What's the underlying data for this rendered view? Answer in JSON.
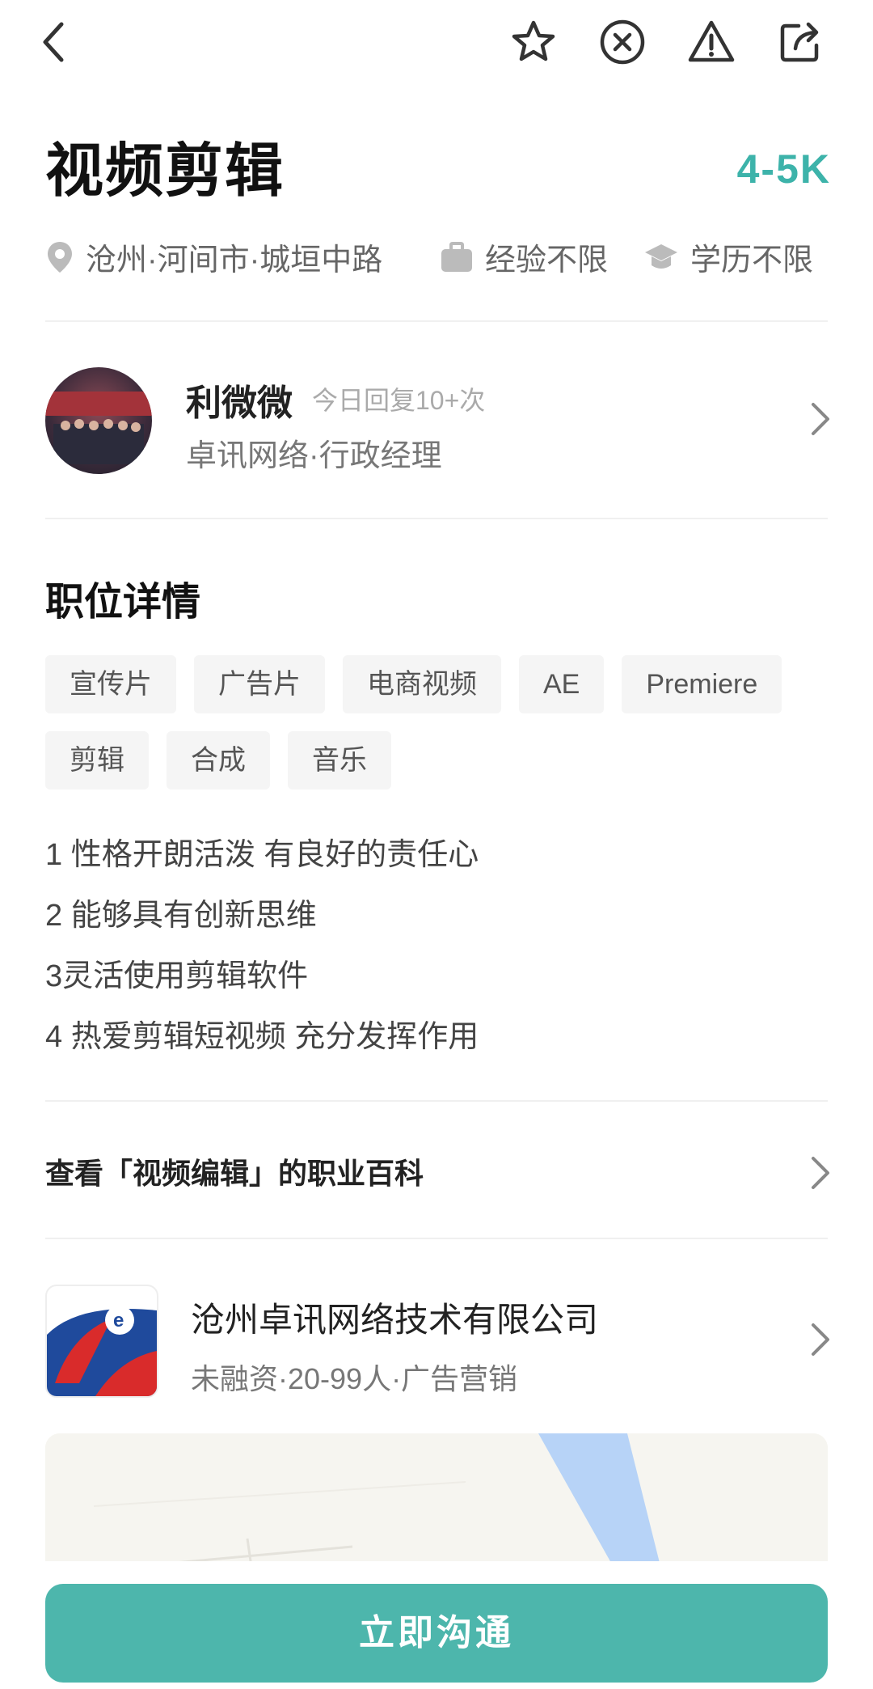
{
  "header": {
    "back_icon": "chevron-left-icon",
    "actions": [
      "star-icon",
      "close-circle-icon",
      "warning-icon",
      "share-icon"
    ]
  },
  "job": {
    "title": "视频剪辑",
    "salary": "4-5K",
    "location": "沧州·河间市·城垣中路",
    "experience": "经验不限",
    "education": "学历不限"
  },
  "recruiter": {
    "name": "利微微",
    "reply_info": "今日回复10+次",
    "role": "卓讯网络·行政经理"
  },
  "details": {
    "title": "职位详情",
    "tags": [
      "宣传片",
      "广告片",
      "电商视频",
      "AE",
      "Premiere",
      "剪辑",
      "合成",
      "音乐"
    ],
    "description": [
      "1 性格开朗活泼 有良好的责任心",
      "2 能够具有创新思维",
      "3灵活使用剪辑软件",
      "4 热爱剪辑短视频 充分发挥作用"
    ]
  },
  "wiki": {
    "label": "查看「视频编辑」的职业百科"
  },
  "company": {
    "name": "沧州卓讯网络技术有限公司",
    "info": "未融资·20-99人·广告营销"
  },
  "cta": {
    "label": "立即沟通"
  },
  "colors": {
    "accent": "#3db3aa",
    "button": "#4db6ac",
    "tag_bg": "#f5f5f5"
  }
}
